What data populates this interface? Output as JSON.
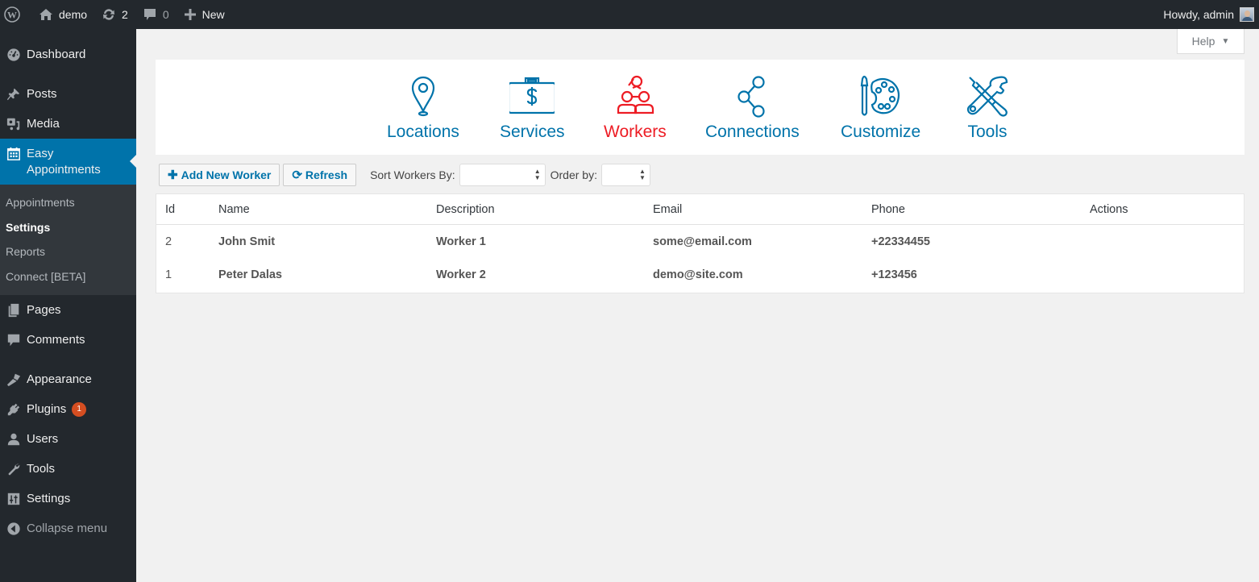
{
  "adminbar": {
    "site_name": "demo",
    "updates_count": "2",
    "comments_count": "0",
    "new_label": "New",
    "greeting": "Howdy, admin"
  },
  "sidebar": {
    "items": [
      {
        "label": "Dashboard",
        "icon": "dashboard-icon"
      },
      {
        "label": "Posts",
        "icon": "pin-icon"
      },
      {
        "label": "Media",
        "icon": "media-icon"
      },
      {
        "label": "Easy Appointments",
        "icon": "calendar-icon",
        "active": true
      },
      {
        "label": "Pages",
        "icon": "pages-icon"
      },
      {
        "label": "Comments",
        "icon": "comment-icon"
      },
      {
        "label": "Appearance",
        "icon": "brush-icon"
      },
      {
        "label": "Plugins",
        "icon": "plug-icon",
        "badge": "1"
      },
      {
        "label": "Users",
        "icon": "user-icon"
      },
      {
        "label": "Tools",
        "icon": "wrench-icon"
      },
      {
        "label": "Settings",
        "icon": "settings-icon"
      },
      {
        "label": "Collapse menu",
        "icon": "collapse-icon"
      }
    ],
    "active_label_line1": "Easy",
    "active_label_line2": "Appointments",
    "submenu": [
      {
        "label": "Appointments"
      },
      {
        "label": "Settings",
        "current": true
      },
      {
        "label": "Reports"
      },
      {
        "label": "Connect [BETA]"
      }
    ]
  },
  "help": {
    "label": "Help"
  },
  "nav": {
    "items": [
      {
        "label": "Locations",
        "icon": "location-pin-icon"
      },
      {
        "label": "Services",
        "icon": "briefcase-dollar-icon"
      },
      {
        "label": "Workers",
        "icon": "workers-icon",
        "active": true
      },
      {
        "label": "Connections",
        "icon": "share-icon"
      },
      {
        "label": "Customize",
        "icon": "palette-icon"
      },
      {
        "label": "Tools",
        "icon": "tools-icon"
      }
    ],
    "colors": {
      "default": "#0073aa",
      "active": "#ed1c24"
    }
  },
  "toolbar": {
    "add_label": "Add New Worker",
    "refresh_label": "Refresh",
    "sort_label": "Sort Workers By:",
    "sort_value": "",
    "order_label": "Order by:",
    "order_value": ""
  },
  "table": {
    "columns": [
      "Id",
      "Name",
      "Description",
      "Email",
      "Phone",
      "Actions"
    ],
    "rows": [
      {
        "id": "2",
        "name": "John Smit",
        "description": "Worker 1",
        "email": "some@email.com",
        "phone": "+22334455",
        "actions": ""
      },
      {
        "id": "1",
        "name": "Peter Dalas",
        "description": "Worker 2",
        "email": "demo@site.com",
        "phone": "+123456",
        "actions": ""
      }
    ]
  }
}
